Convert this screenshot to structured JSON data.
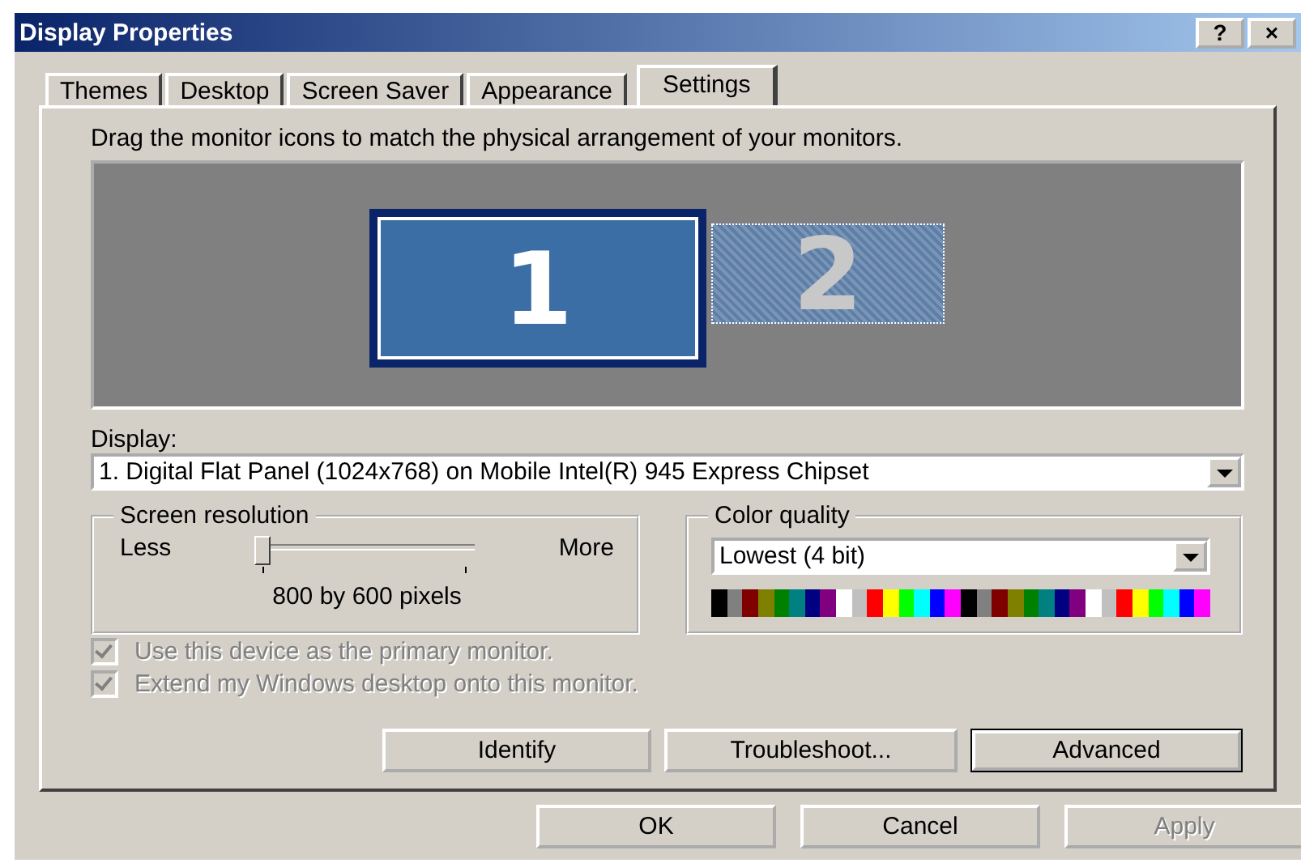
{
  "window": {
    "title": "Display Properties",
    "title_buttons": [
      "?",
      "×"
    ]
  },
  "tabs": [
    {
      "label": "Themes",
      "selected": false
    },
    {
      "label": "Desktop",
      "selected": false
    },
    {
      "label": "Screen Saver",
      "selected": false
    },
    {
      "label": "Appearance",
      "selected": false
    },
    {
      "label": "Settings",
      "selected": true
    }
  ],
  "instructions": "Drag the monitor icons to match the physical arrangement of your monitors.",
  "monitors": [
    {
      "label": "1",
      "selected": true,
      "attached": true
    },
    {
      "label": "2",
      "selected": false,
      "attached": false
    }
  ],
  "display": {
    "label": "Display:",
    "value": "1. Digital Flat Panel (1024x768) on Mobile Intel(R) 945 Express Chipset"
  },
  "screen_resolution": {
    "title": "Screen resolution",
    "min_label": "Less",
    "max_label": "More",
    "level": 0,
    "reading": "800 by 600 pixels"
  },
  "color_quality": {
    "title": "Color quality",
    "value": "Lowest (4 bit)",
    "palette": [
      {
        "color": "#000000"
      },
      {
        "color": "#808080"
      },
      {
        "color": "#800000"
      },
      {
        "color": "#808000"
      },
      {
        "color": "#008000"
      },
      {
        "color": "#008080"
      },
      {
        "color": "#000080"
      },
      {
        "color": "#800080"
      },
      {
        "color": "#ffffff"
      },
      {
        "color": "#c0c0c0"
      },
      {
        "color": "#ff0000"
      },
      {
        "color": "#ffff00"
      },
      {
        "color": "#00ff00"
      },
      {
        "color": "#00ffff"
      },
      {
        "color": "#0000ff"
      },
      {
        "color": "#ff00ff"
      },
      {
        "color": "#000000"
      },
      {
        "color": "#808080"
      },
      {
        "color": "#800000"
      },
      {
        "color": "#808000"
      },
      {
        "color": "#008000"
      },
      {
        "color": "#008080"
      },
      {
        "color": "#000080"
      },
      {
        "color": "#800080"
      },
      {
        "color": "#ffffff"
      },
      {
        "color": "#c0c0c0"
      },
      {
        "color": "#ff0000"
      },
      {
        "color": "#ffff00"
      },
      {
        "color": "#00ff00"
      },
      {
        "color": "#00ffff"
      },
      {
        "color": "#0000ff"
      },
      {
        "color": "#ff00ff"
      }
    ]
  },
  "checkboxes": [
    {
      "label": "Use this device as the primary monitor.",
      "checked": true,
      "disabled": true
    },
    {
      "label": "Extend my Windows desktop onto this monitor.",
      "checked": true,
      "disabled": true
    }
  ],
  "panel_buttons": [
    {
      "label": "Identify",
      "default": false,
      "disabled": false
    },
    {
      "label": "Troubleshoot...",
      "default": false,
      "disabled": false
    },
    {
      "label": "Advanced",
      "default": true,
      "disabled": false
    }
  ],
  "dialog_buttons": [
    {
      "label": "OK",
      "default": false,
      "disabled": false
    },
    {
      "label": "Cancel",
      "default": false,
      "disabled": false
    },
    {
      "label": "Apply",
      "default": false,
      "disabled": true
    }
  ]
}
